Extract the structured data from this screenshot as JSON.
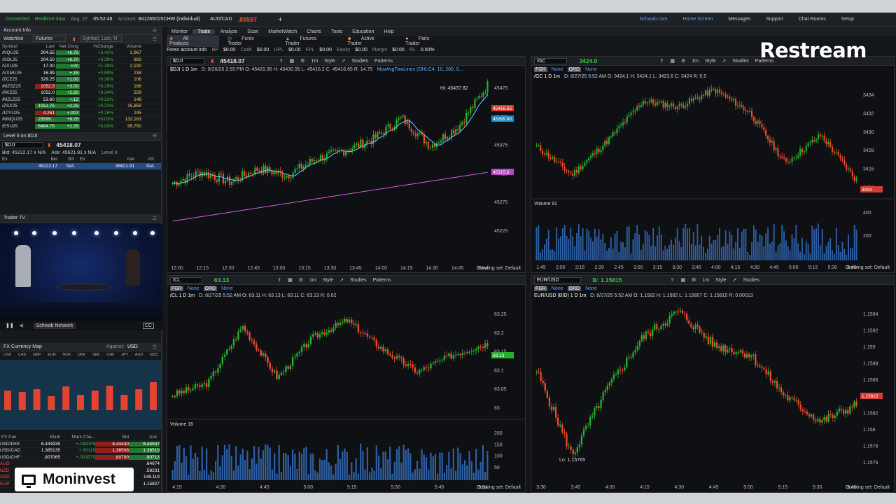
{
  "status": {
    "connected": "Connected",
    "data": "Realtime data",
    "date": "Aug. 27",
    "time": "05:52:48",
    "account_label": "Account:",
    "account": "84126501SCHW (individual)",
    "pair": "AUD/CAD",
    "pair_value": ".89597"
  },
  "top_links": [
    "Schwab.com",
    "Home Screen",
    "Messages",
    "Support",
    "Chat Rooms",
    "Setup"
  ],
  "menu": [
    "Monitor",
    "Trade",
    "Analyze",
    "Scan",
    "MarketWatch",
    "Charts",
    "Tools",
    "Education",
    "Help"
  ],
  "menu_active": "Trade",
  "subtabs": [
    "All Products",
    "Forex Trader",
    "Futures Trader",
    "Active Trader",
    "Pairs Trader"
  ],
  "account_info": {
    "title": "Forex account info",
    "items": [
      "BP",
      "$0.00",
      "Cash",
      "$0.00",
      "UPL",
      "$0.00",
      "FPL",
      "$0.00",
      "Equity",
      "$0.00",
      "Margin",
      "$0.00",
      "RL",
      "0.00%"
    ]
  },
  "left": {
    "account_info": "Account Info",
    "watchlist_title": "Watchlist",
    "watchlist_name": "Futures",
    "search_placeholder": "Symbol, Last, N",
    "headers": [
      "Symbol",
      "Last",
      "Net Chng",
      "%Change",
      "Volume"
    ],
    "rows": [
      {
        "s": "/NQU25",
        "l": "204.55",
        "n": "+6.75",
        "p": "+3.41%",
        "v": "2,967"
      },
      {
        "s": "/SOL25",
        "l": "204.50",
        "n": "+6.70",
        "p": "+3.39%",
        "v": "893"
      },
      {
        "s": "/VXU25",
        "l": "17.00",
        "n": "+20",
        "p": "+1.19%",
        "v": "2,190"
      },
      {
        "s": "/VXMU25",
        "l": "16.99",
        "n": "+.15",
        "p": "+0.89%",
        "v": "238"
      },
      {
        "s": "/ZCZ25",
        "l": "329.25",
        "n": "+1.00",
        "p": "+0.30%",
        "v": "106"
      },
      {
        "s": "/MZSZ25",
        "l": "1052.5",
        "n": "+3.00",
        "p": "+0.29%",
        "v": "166"
      },
      {
        "s": "/XKZ25",
        "l": "1052.0",
        "n": "+2.50",
        "p": "+0.24%",
        "v": "529"
      },
      {
        "s": "/MZLZ25",
        "l": "53.60",
        "n": "+.12",
        "p": "+0.22%",
        "v": "149"
      },
      {
        "s": "/ZSX25",
        "l": "1051.75",
        "n": "+2.25",
        "p": "+0.21%",
        "v": "15,859"
      },
      {
        "s": "/10YU25",
        "l": "4.261",
        "n": "+.007",
        "p": "+0.16%",
        "v": "245"
      },
      {
        "s": "/MNQU25",
        "l": "23599...",
        "n": "+8.25",
        "p": "+0.03%",
        "v": "132,183"
      },
      {
        "s": "/ESU25",
        "l": "6484.75",
        "n": "+2.25",
        "p": "+0.03%",
        "v": "59,750"
      }
    ],
    "level2_title": "Level II on $DJI",
    "level2_sym": "$DJI",
    "level2_last": "45418.07",
    "bid_line": "Bid: 45222.17 x N/A",
    "ask_line": "Ask: 45621.91 x N/A",
    "level2_label": "Level II",
    "l2_headers": [
      "Ex",
      "Bid",
      "BS",
      "Ex",
      "Ask",
      "AS"
    ],
    "l2_row": [
      "",
      "45222.17",
      "N/A",
      "",
      "45621.91",
      "N/A"
    ],
    "tv_title": "Trader TV",
    "tv_network": "Schwab Network",
    "fx_title": "FX Currency Map",
    "fx_against": "Against:",
    "fx_cur": "USD",
    "fx_codes": [
      "USD",
      "CAD",
      "GBP",
      "EUR",
      "NOK",
      "DKK",
      "SEK",
      "CHF",
      "JPY",
      "AUD",
      "NZD"
    ],
    "fx_headers": [
      "FX Pair",
      "Mark",
      "Mark Cha...",
      "Bid",
      "Ask"
    ],
    "fx_rows": [
      {
        "p": "USD/DKK",
        "m": "6.444935",
        "c": "+.032005",
        "b": "6.44440",
        "a": "6.44547"
      },
      {
        "p": "USD/CAD",
        "m": "1.385135",
        "c": "+.00118",
        "b": "1.38508",
        "a": "1.38519"
      },
      {
        "p": "USD/CHF",
        "m": ".807065",
        "c": "+.003575",
        "b": ".80700",
        "a": ".80713"
      },
      {
        "p": "AUD",
        "m": "",
        "c": "",
        "b": "",
        "a": ".64674"
      },
      {
        "p": "NZD",
        "m": "",
        "c": "",
        "b": "",
        "a": ".58231"
      },
      {
        "p": "USD",
        "m": "",
        "c": "",
        "b": "",
        "a": "148.119"
      },
      {
        "p": "EUR",
        "m": "",
        "c": "",
        "b": "",
        "a": "1.15827"
      }
    ]
  },
  "overlays": {
    "restream": "Restream",
    "moninvest": "Moninvest"
  },
  "charts": [
    {
      "symbol": "$DJI",
      "last": "45418.07",
      "title": "$DJI 1 D 1m",
      "info": "D: 8/26/25 2:59 PM  O: 45420.36  H: 45430.95  L: 45416.2  C: 45416.65  R: 14.75",
      "study": "MovAvgTwoLines (OHLC4, 10, 200, 0...",
      "hi_label": "Hi: 45437.82",
      "price_ticks": [
        "45475",
        "45425",
        "45375",
        "45325",
        "45275",
        "45225"
      ],
      "badges": [
        "45416.65",
        "45399.80",
        "45315.8"
      ],
      "time_ticks": [
        "12:00",
        "12:15",
        "12:30",
        "12:45",
        "13:00",
        "13:15",
        "13:30",
        "13:45",
        "14:00",
        "14:15",
        "14:30",
        "14:45",
        "Wed"
      ],
      "drawing": "Drawing set: Default"
    },
    {
      "symbol": "/GC",
      "last": "3424.0",
      "title": "/GC 1 D 1m",
      "info": "D: 8/27/25 5:52 AM  O: 3424.1  H: 3424.1  L: 3423.6  C: 3424  R: 0.5",
      "price_ticks": [
        "3434",
        "3432",
        "3430",
        "3428",
        "3426",
        "3424"
      ],
      "badge": "3424",
      "volume_label": "Volume",
      "volume_val": "91",
      "vol_ticks": [
        "400",
        "200"
      ],
      "time_ticks": [
        "1:45",
        "2:00",
        "2:15",
        "2:30",
        "2:45",
        "3:00",
        "3:15",
        "3:30",
        "3:45",
        "4:00",
        "4:15",
        "4:30",
        "4:45",
        "5:00",
        "5:15",
        "5:30",
        "5:45"
      ],
      "drawing": "Drawing set: Default"
    },
    {
      "symbol": "/CL",
      "last": "63.13",
      "title": "/CL 1 D 1m",
      "info": "D: 8/27/25 5:52 AM  O: 63.11  H: 63.13  L: 63.11  C: 63.13  R: 0.02",
      "price_ticks": [
        "63.25",
        "63.2",
        "63.15",
        "63.1",
        "63.05",
        "63"
      ],
      "badge": "63.13",
      "volume_label": "Volume",
      "volume_val": "16",
      "vol_ticks": [
        "200",
        "150",
        "100",
        "50"
      ],
      "time_ticks": [
        "4:15",
        "4:30",
        "4:45",
        "5:00",
        "5:15",
        "5:30",
        "5:45",
        "5:51"
      ],
      "drawing": "Drawing set: Default"
    },
    {
      "symbol": "EUR/USD",
      "last": "B: 1.15815",
      "title": "EUR/USD (BID) 1 D 1m",
      "info": "D: 8/27/25 5:52 AM  O: 1.1582  H: 1.1582  L: 1.15807  C: 1.15815  R: 0.00013",
      "lo_label": "Lo: 1.15765",
      "price_ticks": [
        "1.1594",
        "1.1592",
        "1.159",
        "1.1588",
        "1.1586",
        "1.1584",
        "1.1582",
        "1.158",
        "1.1578",
        "1.1576"
      ],
      "badge": "1.15815",
      "time_ticks": [
        "3:30",
        "3:45",
        "4:00",
        "4:15",
        "4:30",
        "4:45",
        "5:00",
        "5:15",
        "5:30",
        "5:45"
      ],
      "drawing": "Drawing set: Default"
    }
  ],
  "toolbar": {
    "style": "Style",
    "studies": "Studies",
    "patterns": "Patterns",
    "interval": "1m",
    "fgr_none": "None",
    "ord_none": "None"
  }
}
